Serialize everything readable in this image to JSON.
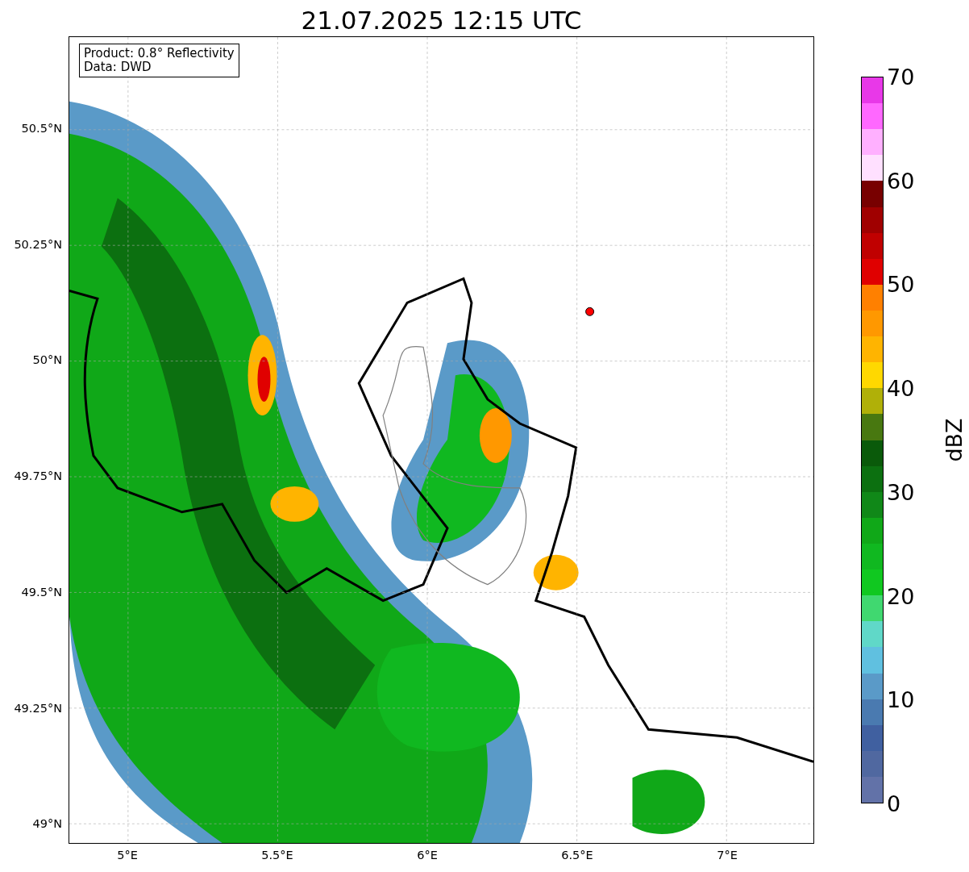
{
  "title": "21.07.2025 12:15 UTC",
  "map": {
    "legend": [
      "Product: 0.8° Reflectivity",
      "Data: DWD"
    ],
    "y_ticks": [
      "50.5°N",
      "50.25°N",
      "50°N",
      "49.75°N",
      "49.5°N",
      "49.25°N",
      "49°N"
    ],
    "x_ticks": [
      "5°E",
      "5.5°E",
      "6°E",
      "6.5°E",
      "7°E"
    ]
  },
  "colorbar": {
    "label": "dBZ",
    "ticks": [
      "70",
      "60",
      "50",
      "40",
      "30",
      "20",
      "10",
      "0"
    ],
    "bands": [
      {
        "color": "#e838e8"
      },
      {
        "color": "#ff68ff"
      },
      {
        "color": "#ffb0ff"
      },
      {
        "color": "#ffe0ff"
      },
      {
        "color": "#780000"
      },
      {
        "color": "#a00000"
      },
      {
        "color": "#c00000"
      },
      {
        "color": "#e00000"
      },
      {
        "color": "#ff8000"
      },
      {
        "color": "#ff9800"
      },
      {
        "color": "#ffb400"
      },
      {
        "color": "#ffd800"
      },
      {
        "color": "#b0b008"
      },
      {
        "color": "#487810"
      },
      {
        "color": "#0a5a0a"
      },
      {
        "color": "#0c7010"
      },
      {
        "color": "#108818"
      },
      {
        "color": "#10a818"
      },
      {
        "color": "#10b820"
      },
      {
        "color": "#10c820"
      },
      {
        "color": "#40d870"
      },
      {
        "color": "#60d8c8"
      },
      {
        "color": "#60c0e0"
      },
      {
        "color": "#5a9ac8"
      },
      {
        "color": "#4a7ab0"
      },
      {
        "color": "#4060a0"
      },
      {
        "color": "#5068a0"
      },
      {
        "color": "#6272a8"
      }
    ]
  }
}
